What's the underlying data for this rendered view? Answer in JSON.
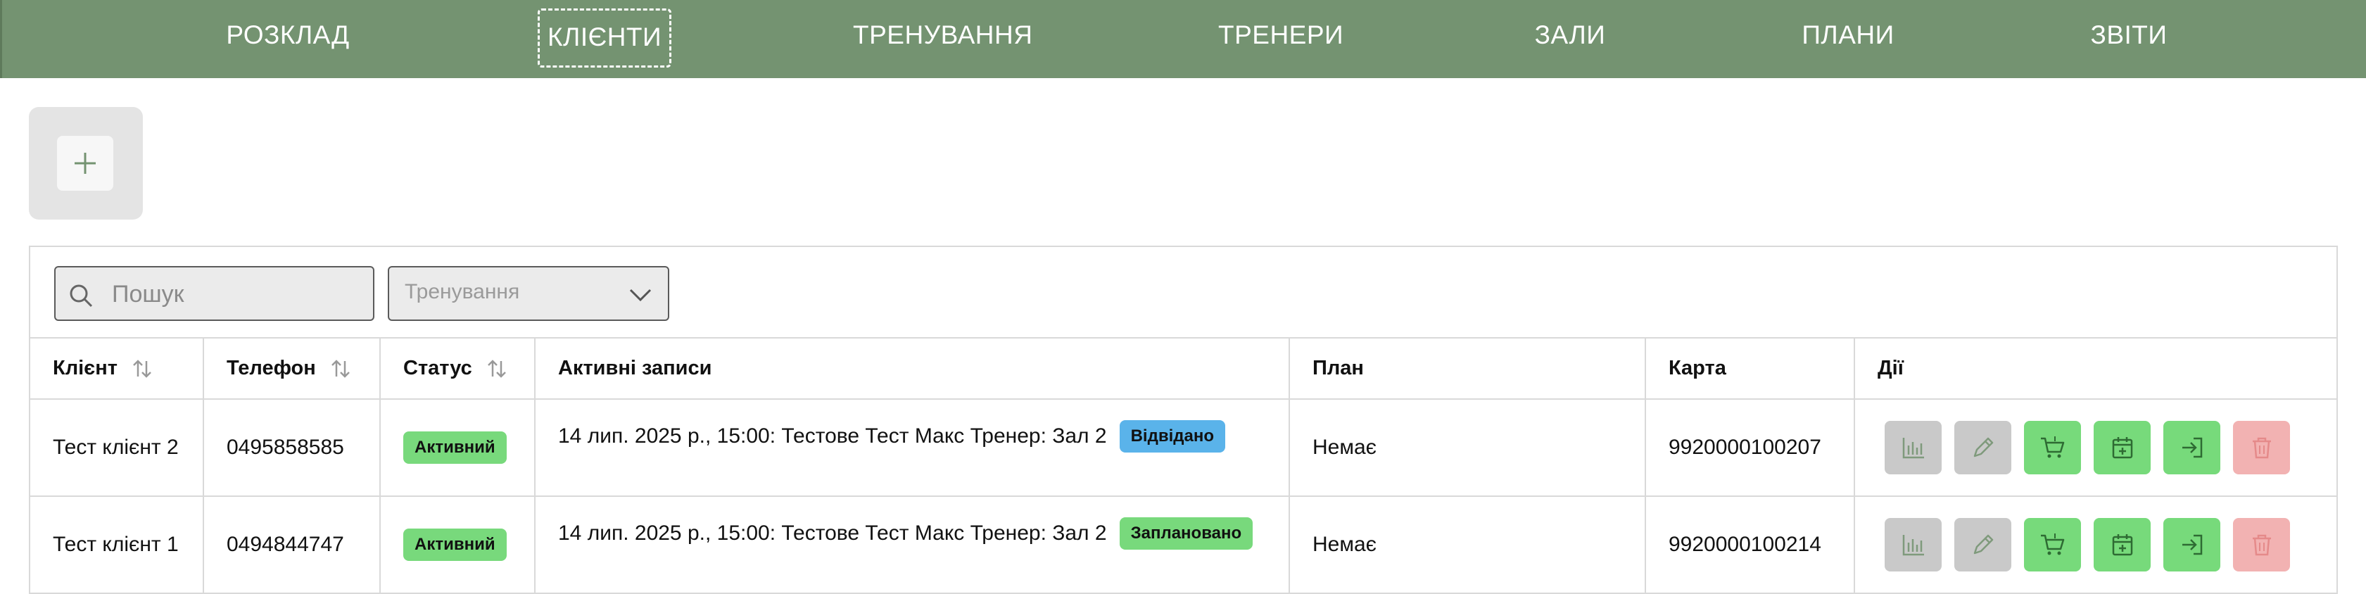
{
  "nav": {
    "items": [
      "РОЗКЛАД",
      "КЛІЄНТИ",
      "ТРЕНУВАННЯ",
      "ТРЕНЕРИ",
      "ЗАЛИ",
      "ПЛАНИ",
      "ЗВІТИ"
    ],
    "active": "КЛІЄНТИ"
  },
  "add": {
    "icon": "plus-icon"
  },
  "filters": {
    "search_placeholder": "Пошук",
    "training_select": "Тренування"
  },
  "table": {
    "headers": {
      "client": "Клієнт",
      "phone": "Телефон",
      "status": "Статус",
      "records": "Активні записи",
      "plan": "План",
      "card": "Карта",
      "actions": "Дії"
    },
    "rows": [
      {
        "client": "Тест клієнт 2",
        "phone": "0495858585",
        "status": "Активний",
        "record": "14 лип. 2025 р., 15:00: Тестове Тест Макс Тренер: Зал 2",
        "record_status": "Відвідано",
        "plan": "Немає",
        "card": "9920000100207"
      },
      {
        "client": "Тест клієнт 1",
        "phone": "0494844747",
        "status": "Активний",
        "record": "14 лип. 2025 р., 15:00: Тестове Тест Макс Тренер: Зал 2",
        "record_status": "Заплановано",
        "plan": "Немає",
        "card": "9920000100214"
      }
    ]
  },
  "action_icons": [
    "stats-icon",
    "edit-icon",
    "cart-icon",
    "calendar-add-icon",
    "login-icon",
    "trash-icon"
  ],
  "colors": {
    "nav_bg": "#749371",
    "badge_green": "#78d97c",
    "badge_blue": "#5ab3ea",
    "action_gray": "#c9c9c9",
    "action_green": "#77da7b",
    "action_red": "#f2b2b2"
  }
}
